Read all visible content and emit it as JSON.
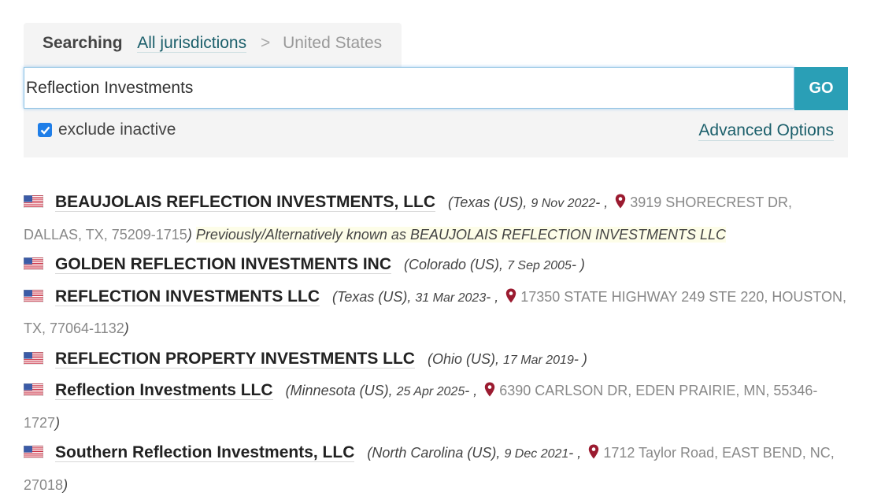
{
  "search": {
    "searching_label": "Searching",
    "jurisdiction_all": "All jurisdictions",
    "separator": ">",
    "jurisdiction_current": "United States",
    "query": "Reflection Investments",
    "go_label": "GO",
    "exclude_inactive_label": "exclude inactive",
    "exclude_inactive_checked": true,
    "advanced_options_label": "Advanced Options"
  },
  "colors": {
    "accent": "#2a9fb6",
    "link": "#1b5f6b",
    "pin": "#9b1b30"
  },
  "results": [
    {
      "flag": "us-flag-icon",
      "name": "BEAUJOLAIS REFLECTION INVESTMENTS, LLC",
      "jurisdiction": "(Texas (US),",
      "date": "9 Nov 2022",
      "status_suffix": "- ,",
      "address": "3919 SHORECREST DR, DALLAS, TX, 75209-1715",
      "close": ")",
      "aka": "Previously/Alternatively known as BEAUJOLAIS REFLECTION INVESTMENTS LLC"
    },
    {
      "flag": "us-flag-icon",
      "name": "GOLDEN REFLECTION INVESTMENTS INC",
      "jurisdiction": "(Colorado (US),",
      "date": "7 Sep 2005",
      "status_suffix": "- )"
    },
    {
      "flag": "us-flag-icon",
      "name": "REFLECTION INVESTMENTS LLC",
      "jurisdiction": "(Texas (US),",
      "date": "31 Mar 2023",
      "status_suffix": "- ,",
      "address": "17350 STATE HIGHWAY 249 STE 220, HOUSTON, TX, 77064-1132",
      "close": ")"
    },
    {
      "flag": "us-flag-icon",
      "name": "REFLECTION PROPERTY INVESTMENTS LLC",
      "jurisdiction": "(Ohio (US),",
      "date": "17 Mar 2019",
      "status_suffix": "- )"
    },
    {
      "flag": "us-flag-icon",
      "name": "Reflection Investments LLC",
      "jurisdiction": "(Minnesota (US),",
      "date": "25 Apr 2025",
      "status_suffix": "- ,",
      "address": "6390 CARLSON DR, EDEN PRAIRIE, MN, 55346-1727",
      "close": ")"
    },
    {
      "flag": "us-flag-icon",
      "name": "Southern Reflection Investments, LLC",
      "jurisdiction": "(North Carolina (US),",
      "date": "9 Dec 2021",
      "status_suffix": "- ,",
      "address": "1712 Taylor Road, EAST BEND, NC, 27018",
      "close": ")"
    }
  ]
}
